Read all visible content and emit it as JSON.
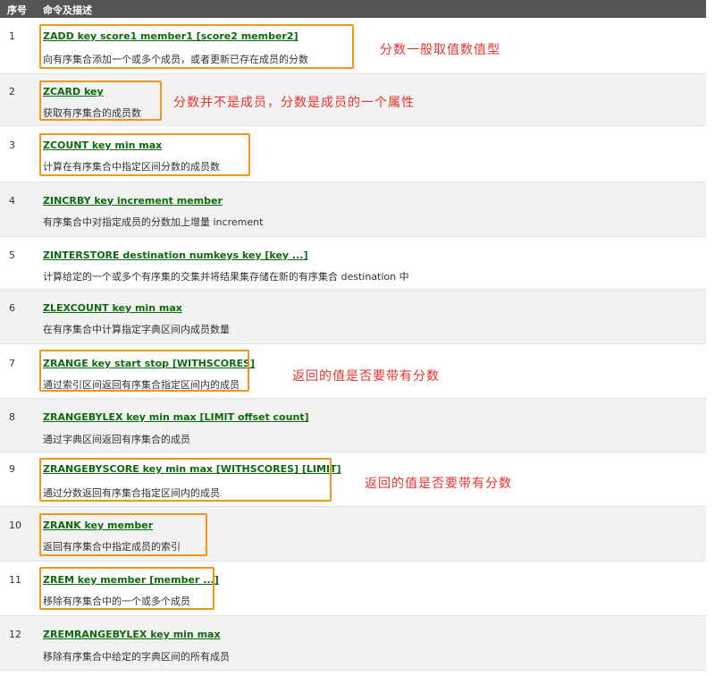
{
  "header": {
    "index_label": "序号",
    "command_label": "命令及描述"
  },
  "rows": [
    {
      "index": "1",
      "command": "ZADD key score1 member1 [score2 member2]",
      "description": "向有序集合添加一个或多个成员，或者更新已存在成员的分数"
    },
    {
      "index": "2",
      "command": "ZCARD key",
      "description": "获取有序集合的成员数"
    },
    {
      "index": "3",
      "command": "ZCOUNT key min max",
      "description": "计算在有序集合中指定区间分数的成员数"
    },
    {
      "index": "4",
      "command": "ZINCRBY key increment member",
      "description": "有序集合中对指定成员的分数加上增量 increment"
    },
    {
      "index": "5",
      "command": "ZINTERSTORE destination numkeys key [key ...]",
      "description": "计算给定的一个或多个有序集的交集并将结果集存储在新的有序集合 destination 中"
    },
    {
      "index": "6",
      "command": "ZLEXCOUNT key min max",
      "description": "在有序集合中计算指定字典区间内成员数量"
    },
    {
      "index": "7",
      "command": "ZRANGE key start stop [WITHSCORES]",
      "description": "通过索引区间返回有序集合指定区间内的成员"
    },
    {
      "index": "8",
      "command": "ZRANGEBYLEX key min max [LIMIT offset count]",
      "description": "通过字典区间返回有序集合的成员"
    },
    {
      "index": "9",
      "command": "ZRANGEBYSCORE key min max [WITHSCORES] [LIMIT]",
      "description": "通过分数返回有序集合指定区间内的成员"
    },
    {
      "index": "10",
      "command": "ZRANK key member",
      "description": "返回有序集合中指定成员的索引"
    },
    {
      "index": "11",
      "command": "ZREM key member [member ...]",
      "description": "移除有序集合中的一个或多个成员"
    },
    {
      "index": "12",
      "command": "ZREMRANGEBYLEX key min max",
      "description": "移除有序集合中给定的字典区间的所有成员"
    }
  ],
  "annotations": {
    "row1": "分数一般取值数值型",
    "row2": "分数并不是成员，分数是成员的一个属性",
    "row7": "返回的值是否要带有分数",
    "row9": "返回的值是否要带有分数"
  },
  "colors": {
    "header_bg": "#555555",
    "link_green": "#0c6b0c",
    "highlight_orange": "#f0961e",
    "note_red": "#e8322d"
  }
}
